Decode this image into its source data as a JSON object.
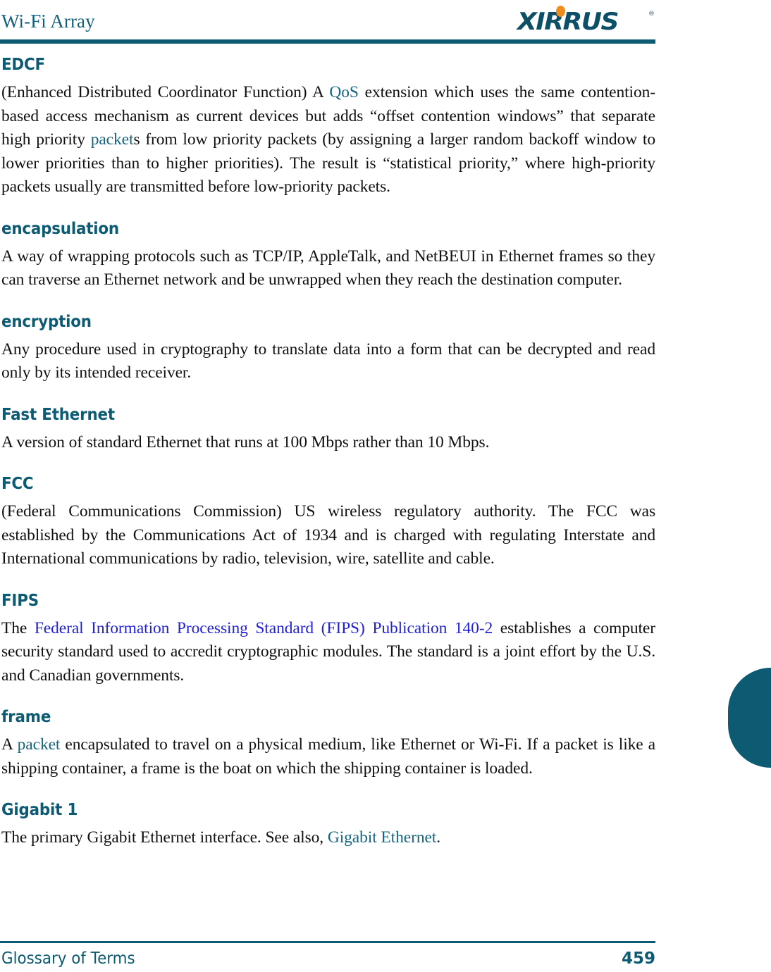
{
  "header": {
    "title": "Wi-Fi Array",
    "logo_text": "XIRRUS",
    "logo_trademark": "®",
    "brand_color": "#0d5a73",
    "accent_color": "#f08b1d"
  },
  "footer": {
    "section": "Glossary of Terms",
    "page_number": "459"
  },
  "colors": {
    "heading": "#0d5a73",
    "xref_link": "#15657f",
    "external_link": "#2222d8",
    "body": "#111111"
  },
  "entries": [
    {
      "term": "EDCF",
      "def_part1": "(Enhanced Distributed Coordinator Function) A ",
      "link1": "QoS",
      "def_part2": " extension which uses the same contention-based access mechanism as current devices but adds “offset contention windows” that separate high priority ",
      "link2": "packet",
      "def_part3": "s from low priority packets (by assigning a larger random backoff window to lower priorities than to higher priorities). The result is “statistical priority,” where high-priority packets usually are transmitted before low-priority packets."
    },
    {
      "term": "encapsulation",
      "def": "A way of wrapping protocols such as TCP/IP, AppleTalk, and NetBEUI in Ethernet frames so they can traverse an Ethernet network and be unwrapped when they reach the destination computer."
    },
    {
      "term": "encryption",
      "def": "Any procedure used in cryptography to translate data into a form that can be decrypted and read only by its intended receiver."
    },
    {
      "term": "Fast Ethernet",
      "def": "A version of standard Ethernet that runs at 100 Mbps rather than 10 Mbps."
    },
    {
      "term": "FCC",
      "def": "(Federal Communications Commission) US wireless regulatory authority. The FCC was established by the Communications Act of 1934 and is charged with regulating Interstate and International communications by radio, television, wire, satellite and cable."
    },
    {
      "term": "FIPS",
      "def_part1": "The ",
      "link1": "Federal Information Processing Standard (FIPS) Publication 140-2",
      "def_part2": " establishes a computer security standard used to accredit cryptographic modules. The standard is a joint effort by the U.S. and Canadian governments."
    },
    {
      "term": "frame",
      "def_part1": "A ",
      "link1": "packet",
      "def_part2": " encapsulated to travel on a physical medium, like Ethernet or Wi-Fi. If a packet is like a shipping container, a frame is the boat on which the shipping container is loaded."
    },
    {
      "term": "Gigabit 1",
      "def_part1": "The primary Gigabit Ethernet interface. See also, ",
      "link1": "Gigabit Ethernet",
      "def_part2": "."
    }
  ]
}
